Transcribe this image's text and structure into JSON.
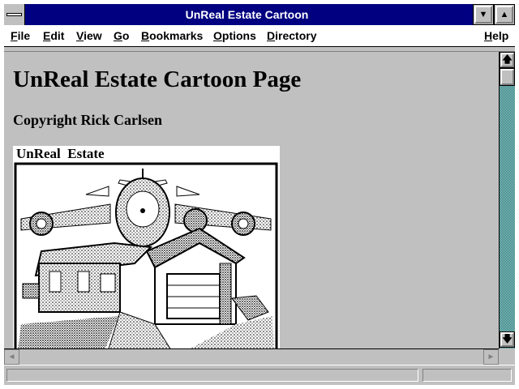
{
  "window": {
    "title": "UnReal Estate Cartoon",
    "minimize_glyph": "▼",
    "maximize_glyph": "▲"
  },
  "menu": [
    {
      "label": "File",
      "accel": "F",
      "rest": "ile"
    },
    {
      "label": "Edit",
      "accel": "E",
      "rest": "dit"
    },
    {
      "label": "View",
      "accel": "V",
      "rest": "iew"
    },
    {
      "label": "Go",
      "accel": "G",
      "rest": "o"
    },
    {
      "label": "Bookmarks",
      "accel": "B",
      "rest": "ookmarks"
    },
    {
      "label": "Options",
      "accel": "O",
      "rest": "ptions"
    },
    {
      "label": "Directory",
      "accel": "D",
      "rest": "irectory"
    },
    {
      "label": "Help",
      "accel": "H",
      "rest": "elp"
    }
  ],
  "page": {
    "heading": "UnReal Estate Cartoon Page",
    "copyright": "Copyright Rick Carlsen",
    "cartoon_caption": "UnReal  Estate"
  },
  "icons": {
    "scroll_up": "up-arrow-icon",
    "scroll_down": "down-arrow-icon",
    "scroll_left": "left-arrow-icon",
    "scroll_right": "right-arrow-icon",
    "system_menu": "system-menu-icon"
  },
  "colors": {
    "title_bar": "#000080",
    "window_bg": "#c0c0c0",
    "scroll_track": "#008080"
  }
}
